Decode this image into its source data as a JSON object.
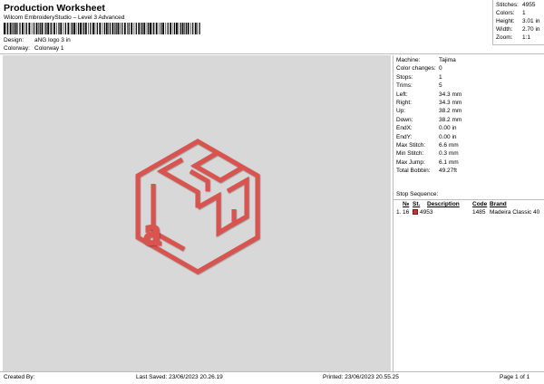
{
  "header": {
    "title": "Production Worksheet",
    "subtitle": "Wilcom EmbroideryStudio – Level 3 Advanced",
    "design_label": "Design:",
    "design_value": "aNG logo 3 in",
    "colorway_label": "Colorway:",
    "colorway_value": "Colorway 1"
  },
  "stats": {
    "stitches_label": "Stitches:",
    "stitches": "4955",
    "colors_label": "Colors:",
    "colors": "1",
    "height_label": "Height:",
    "height": "3.01 in",
    "width_label": "Width:",
    "width": "2.70 in",
    "zoom_label": "Zoom:",
    "zoom": "1:1"
  },
  "machine_info": [
    {
      "label": "Machine:",
      "value": "Tajima"
    },
    {
      "label": "Color changes:",
      "value": "0"
    },
    {
      "label": "Stops:",
      "value": "1"
    },
    {
      "label": "Trims:",
      "value": "5"
    },
    {
      "label": "Left:",
      "value": "34.3 mm"
    },
    {
      "label": "Right:",
      "value": "34.3 mm"
    },
    {
      "label": "Up:",
      "value": "38.2 mm"
    },
    {
      "label": "Down:",
      "value": "38.2 mm"
    },
    {
      "label": "EndX:",
      "value": "0.00 in"
    },
    {
      "label": "EndY:",
      "value": "0.00 in"
    },
    {
      "label": "Max Stitch:",
      "value": "6.6 mm"
    },
    {
      "label": "Min Stitch:",
      "value": "0.3 mm"
    },
    {
      "label": "Max Jump:",
      "value": "6.1 mm"
    },
    {
      "label": "Total Bobbin:",
      "value": "49.27ft"
    }
  ],
  "stop_sequence": {
    "title": "Stop Sequence:",
    "columns": [
      "№",
      "St.",
      "Description",
      "Code",
      "Brand"
    ],
    "rows": [
      {
        "index": "1.",
        "num": "16",
        "stitches": "4953",
        "code": "1485",
        "brand": "Madeira Classic 40",
        "color": "#cc3333"
      }
    ]
  },
  "design": {
    "thread_color": "#d9534f",
    "background": "#d8d8d8",
    "letter_a": "a"
  },
  "footer": {
    "created_by": "Created By:",
    "last_saved": "Last Saved: 23/06/2023 20.26.19",
    "printed": "Printed: 23/06/2023 20.55.25",
    "page": "Page 1 of 1"
  }
}
